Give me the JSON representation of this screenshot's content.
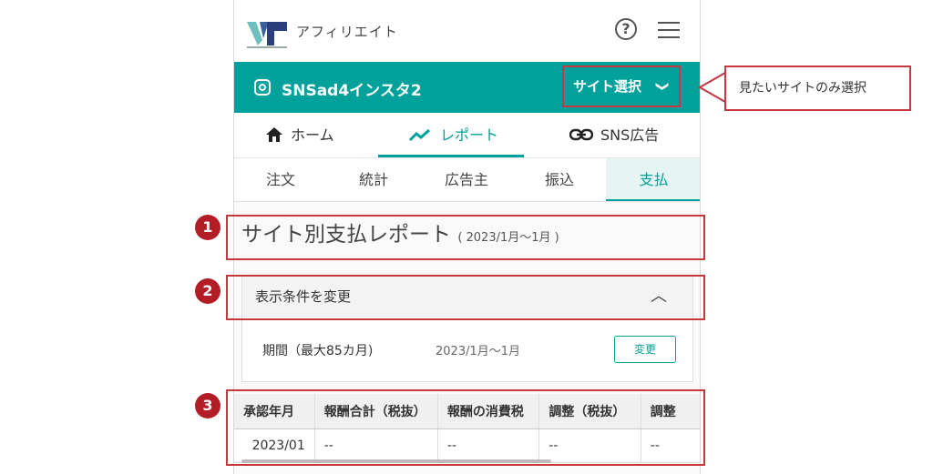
{
  "header": {
    "brand": "アフィリエイト",
    "help_icon_glyph": "?"
  },
  "site_bar": {
    "site_name": "SNSad4インスタ2",
    "site_select_label": "サイト選択",
    "site_select_chevron": "❯"
  },
  "nav": {
    "home_label": "ホーム",
    "report_label": "レポート",
    "sns_label": "SNS広告"
  },
  "subtabs": [
    "注文",
    "統計",
    "広告主",
    "振込",
    "支払"
  ],
  "page": {
    "title": "サイト別支払レポート",
    "range": "( 2023/1月～1月 )"
  },
  "conditions": {
    "header": "表示条件を変更",
    "caret": "︿",
    "period_label": "期間（最大85カ月)",
    "period_value": "2023/1月～1月",
    "change_button": "変更"
  },
  "table": {
    "columns": [
      "承認年月",
      "報酬合計（税抜）",
      "報酬の消費税",
      "調整（税抜）",
      "調整"
    ],
    "rows": [
      [
        "2023/01",
        "--",
        "--",
        "--",
        "--"
      ]
    ]
  },
  "annotations": {
    "callout": "見たいサイトのみ選択",
    "markers": [
      "1",
      "2",
      "3"
    ]
  },
  "colors": {
    "accent": "#00a19a",
    "annotation_red": "#c7373d",
    "marker_red": "#b31e26"
  }
}
